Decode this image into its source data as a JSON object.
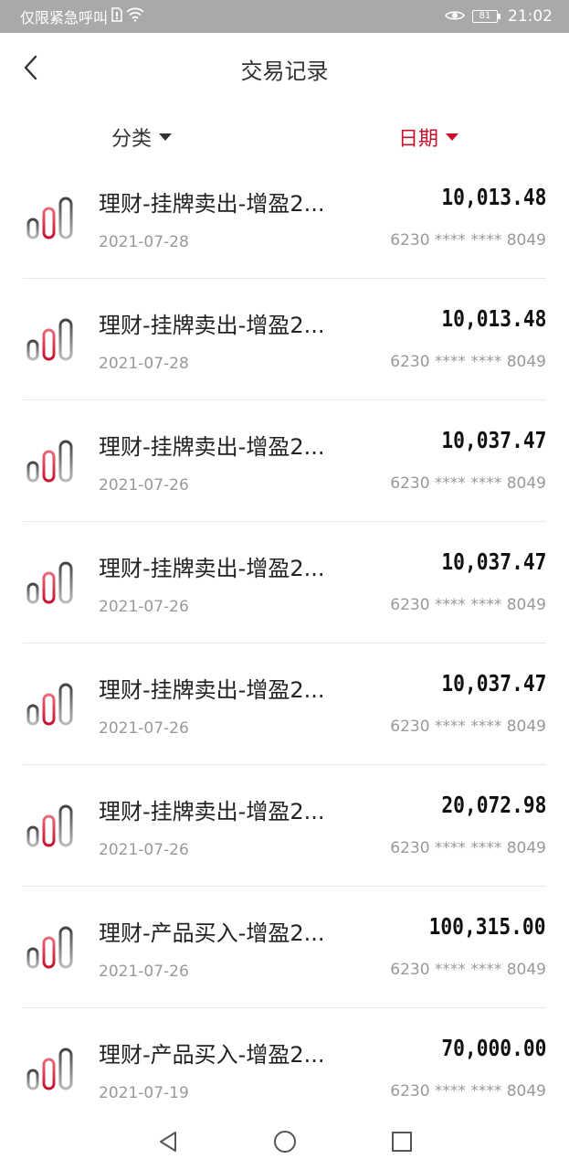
{
  "status_bar": {
    "carrier": "仅限紧急呼叫",
    "battery": "81",
    "time": "21:02"
  },
  "header": {
    "title": "交易记录"
  },
  "filters": {
    "category_label": "分类",
    "date_label": "日期",
    "active_color": "#c8102e"
  },
  "transactions": [
    {
      "title": "理财-挂牌卖出-增盈2...",
      "date": "2021-07-28",
      "amount": "10,013.48",
      "card": "6230 **** **** 8049"
    },
    {
      "title": "理财-挂牌卖出-增盈2...",
      "date": "2021-07-28",
      "amount": "10,013.48",
      "card": "6230 **** **** 8049"
    },
    {
      "title": "理财-挂牌卖出-增盈2...",
      "date": "2021-07-26",
      "amount": "10,037.47",
      "card": "6230 **** **** 8049"
    },
    {
      "title": "理财-挂牌卖出-增盈2...",
      "date": "2021-07-26",
      "amount": "10,037.47",
      "card": "6230 **** **** 8049"
    },
    {
      "title": "理财-挂牌卖出-增盈2...",
      "date": "2021-07-26",
      "amount": "10,037.47",
      "card": "6230 **** **** 8049"
    },
    {
      "title": "理财-挂牌卖出-增盈2...",
      "date": "2021-07-26",
      "amount": "20,072.98",
      "card": "6230 **** **** 8049"
    },
    {
      "title": "理财-产品买入-增盈2...",
      "date": "2021-07-26",
      "amount": "100,315.00",
      "card": "6230 **** **** 8049"
    },
    {
      "title": "理财-产品买入-增盈2...",
      "date": "2021-07-19",
      "amount": "70,000.00",
      "card": "6230 **** **** 8049"
    }
  ],
  "icons": {
    "back": "chevron-left-icon",
    "row": "wealth-bars-icon",
    "nav_back": "triangle-back-icon",
    "nav_home": "circle-home-icon",
    "nav_recent": "square-recent-icon"
  }
}
